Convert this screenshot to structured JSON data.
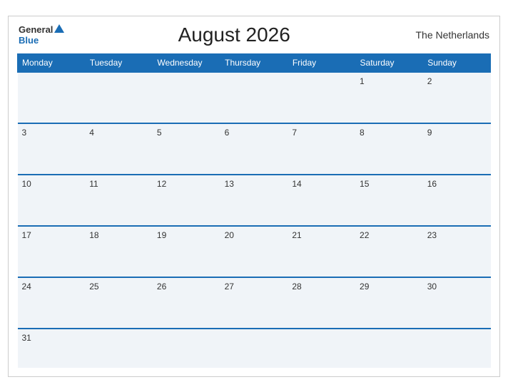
{
  "header": {
    "logo_general": "General",
    "logo_blue": "Blue",
    "title": "August 2026",
    "country": "The Netherlands"
  },
  "weekdays": [
    "Monday",
    "Tuesday",
    "Wednesday",
    "Thursday",
    "Friday",
    "Saturday",
    "Sunday"
  ],
  "weeks": [
    [
      {
        "day": "",
        "empty": true
      },
      {
        "day": "",
        "empty": true
      },
      {
        "day": "",
        "empty": true
      },
      {
        "day": "",
        "empty": true
      },
      {
        "day": "",
        "empty": true
      },
      {
        "day": "1",
        "empty": false
      },
      {
        "day": "2",
        "empty": false
      }
    ],
    [
      {
        "day": "3",
        "empty": false
      },
      {
        "day": "4",
        "empty": false
      },
      {
        "day": "5",
        "empty": false
      },
      {
        "day": "6",
        "empty": false
      },
      {
        "day": "7",
        "empty": false
      },
      {
        "day": "8",
        "empty": false
      },
      {
        "day": "9",
        "empty": false
      }
    ],
    [
      {
        "day": "10",
        "empty": false
      },
      {
        "day": "11",
        "empty": false
      },
      {
        "day": "12",
        "empty": false
      },
      {
        "day": "13",
        "empty": false
      },
      {
        "day": "14",
        "empty": false
      },
      {
        "day": "15",
        "empty": false
      },
      {
        "day": "16",
        "empty": false
      }
    ],
    [
      {
        "day": "17",
        "empty": false
      },
      {
        "day": "18",
        "empty": false
      },
      {
        "day": "19",
        "empty": false
      },
      {
        "day": "20",
        "empty": false
      },
      {
        "day": "21",
        "empty": false
      },
      {
        "day": "22",
        "empty": false
      },
      {
        "day": "23",
        "empty": false
      }
    ],
    [
      {
        "day": "24",
        "empty": false
      },
      {
        "day": "25",
        "empty": false
      },
      {
        "day": "26",
        "empty": false
      },
      {
        "day": "27",
        "empty": false
      },
      {
        "day": "28",
        "empty": false
      },
      {
        "day": "29",
        "empty": false
      },
      {
        "day": "30",
        "empty": false
      }
    ],
    [
      {
        "day": "31",
        "empty": false
      },
      {
        "day": "",
        "empty": true
      },
      {
        "day": "",
        "empty": true
      },
      {
        "day": "",
        "empty": true
      },
      {
        "day": "",
        "empty": true
      },
      {
        "day": "",
        "empty": true
      },
      {
        "day": "",
        "empty": true
      }
    ]
  ]
}
